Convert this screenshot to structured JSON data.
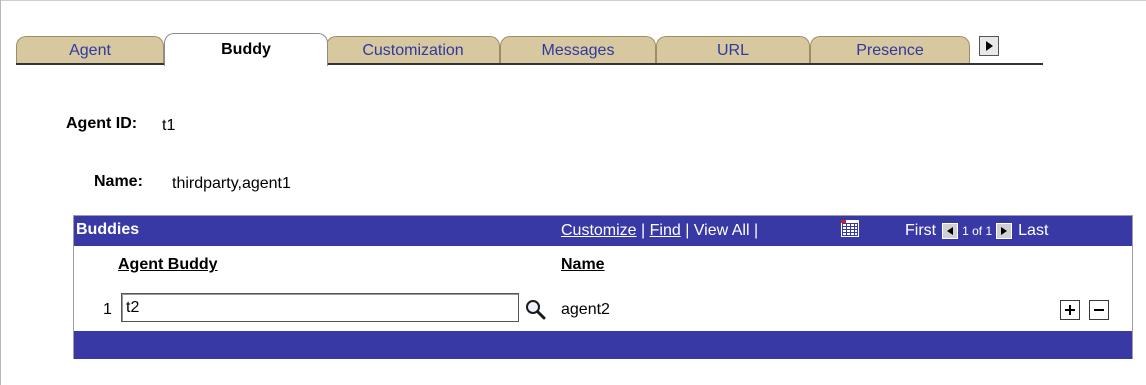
{
  "tabs": [
    {
      "label": "Agent",
      "active": false
    },
    {
      "label": "Buddy",
      "active": true
    },
    {
      "label": "Customization",
      "active": false
    },
    {
      "label": "Messages",
      "active": false
    },
    {
      "label": "URL",
      "active": false
    },
    {
      "label": "Presence",
      "active": false
    }
  ],
  "fields": {
    "agent_id_label": "Agent ID:",
    "agent_id_value": "t1",
    "name_label": "Name:",
    "name_value": "thirdparty,agent1"
  },
  "grid": {
    "title": "Buddies",
    "customize": "Customize",
    "find": "Find",
    "view_all": "View All",
    "first": "First",
    "page_info": "1 of 1",
    "last": "Last",
    "columns": [
      "Agent Buddy",
      "Name"
    ],
    "rows": [
      {
        "num": "1",
        "agent_buddy": "t2",
        "name": "agent2"
      }
    ]
  },
  "colors": {
    "tab_inactive": "#d7c8a0",
    "tab_text": "#2d3aa1",
    "grid_header": "#3939a5"
  },
  "icons": {
    "lookup": "magnifier-icon",
    "add_row": "plus-icon",
    "delete_row": "minus-icon",
    "grid_download": "grid-download-icon",
    "tab_scroll": "right-arrow-icon"
  }
}
